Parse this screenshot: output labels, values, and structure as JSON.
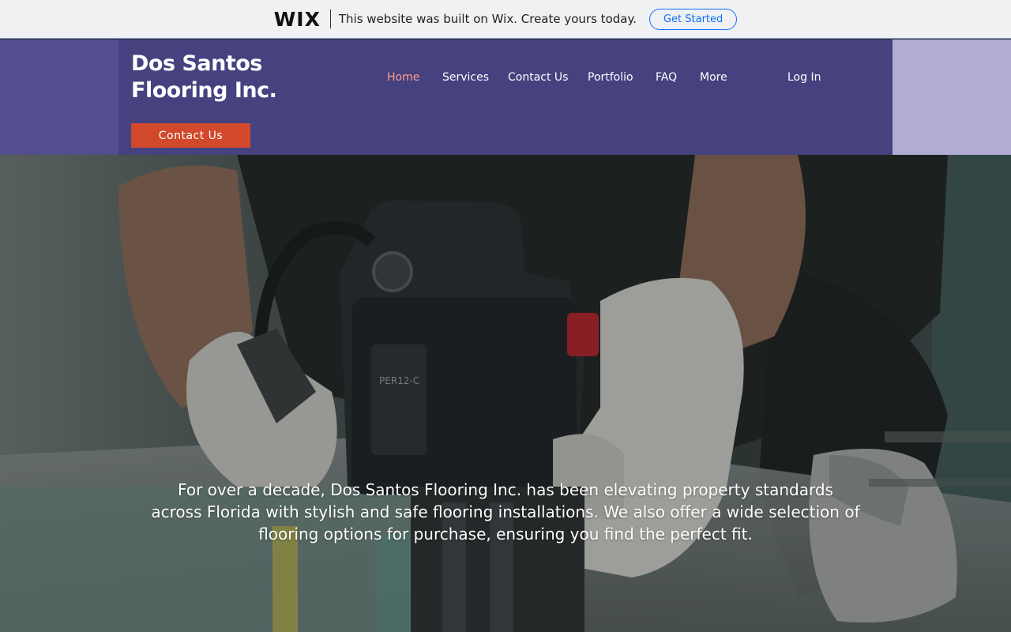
{
  "wix_banner": {
    "logo": "WIX",
    "message": "This website was built on Wix. Create yours today.",
    "cta": "Get Started"
  },
  "header": {
    "site_title": "Dos Santos Flooring Inc.",
    "cta_label": "Contact Us",
    "nav": [
      {
        "label": "Home",
        "active": true
      },
      {
        "label": "Services"
      },
      {
        "label": "Contact Us"
      },
      {
        "label": "Portfolio"
      },
      {
        "label": "FAQ"
      },
      {
        "label": "More"
      }
    ],
    "login_label": "Log In"
  },
  "hero": {
    "text": "For over a decade, Dos Santos Flooring Inc. has been elevating property standards across Florida with stylish and safe flooring installations. We also offer a wide selection of flooring options for purchase, ensuring you find the perfect fit.",
    "tool_model": "PER12-C"
  },
  "colors": {
    "header_bg": "#46417f",
    "header_left": "#544d8f",
    "header_right": "#b2acd3",
    "accent": "#d1482a",
    "active_nav": "#ff9d8a",
    "wix_blue": "#116dff"
  }
}
